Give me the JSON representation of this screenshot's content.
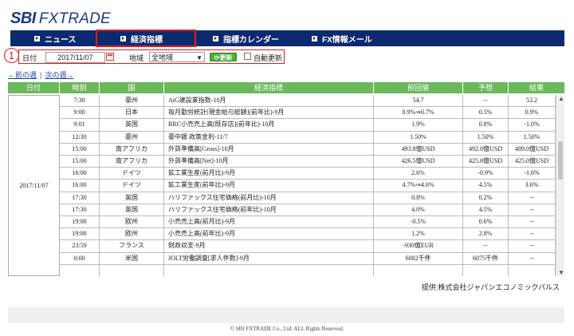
{
  "logo": {
    "sbi": "SBI",
    "fx": "FXTRADE"
  },
  "nav": [
    {
      "label": "ニュース"
    },
    {
      "label": "経済指標"
    },
    {
      "label": "指標カレンダー"
    },
    {
      "label": "FX情報メール"
    }
  ],
  "annotation_number": "1",
  "filter": {
    "date_label": "日付",
    "date_value": "2017/11/07",
    "region_label": "地域",
    "region_value": "全地域",
    "refresh_label": "更新",
    "auto_refresh_label": "自動更新"
  },
  "week_nav": {
    "prev": "←前の週",
    "next": "次の週→"
  },
  "table": {
    "headers": [
      "日付",
      "時刻",
      "国",
      "経済指標",
      "前回値",
      "予想",
      "結果"
    ],
    "date": "2017/11/07",
    "rows": [
      {
        "time": "7:30",
        "country": "豪州",
        "name": "AiG建設業指数-10月",
        "prev": "54.7",
        "fore": "--",
        "res": "53.2"
      },
      {
        "time": "9:00",
        "country": "日本",
        "name": "毎月勤労統計[現金給与総額](前年比)-9月",
        "prev": "0.9%⇒0.7%",
        "fore": "0.5%",
        "res": "0.9%"
      },
      {
        "time": "9:01",
        "country": "英国",
        "name": "BRC小売売上高[既存店](前年比)-10月",
        "prev": "1.9%",
        "fore": "0.8%",
        "res": "-1.0%"
      },
      {
        "time": "12:30",
        "country": "豪州",
        "name": "豪中銀 政策金利-11/7",
        "prev": "1.50%",
        "fore": "1.50%",
        "res": "1.50%"
      },
      {
        "time": "15:00",
        "country": "南アフリカ",
        "name": "外貨準備高[Gross]-10月",
        "prev": "493.8億USD",
        "fore": "492.0億USD",
        "res": "489.0億USD"
      },
      {
        "time": "15:00",
        "country": "南アフリカ",
        "name": "外貨準備高[Net]-10月",
        "prev": "426.5億USD",
        "fore": "425.0億USD",
        "res": "425.0億USD"
      },
      {
        "time": "16:00",
        "country": "ドイツ",
        "name": "鉱工業生産(前月比)-9月",
        "prev": "2.6%",
        "fore": "-0.9%",
        "res": "-1.6%"
      },
      {
        "time": "16:00",
        "country": "ドイツ",
        "name": "鉱工業生産(前年比)-9月",
        "prev": "4.7%⇒4.6%",
        "fore": "4.5%",
        "res": "3.6%"
      },
      {
        "time": "17:30",
        "country": "英国",
        "name": "ハリファックス住宅価格(前月比)-10月",
        "prev": "0.8%",
        "fore": "0.2%",
        "res": "--"
      },
      {
        "time": "17:30",
        "country": "英国",
        "name": "ハリファックス住宅価格(前年比)-10月",
        "prev": "4.0%",
        "fore": "4.5%",
        "res": "--"
      },
      {
        "time": "19:00",
        "country": "欧州",
        "name": "小売売上高(前月比)-9月",
        "prev": "-0.5%",
        "fore": "0.6%",
        "res": "--"
      },
      {
        "time": "19:00",
        "country": "欧州",
        "name": "小売売上高(前年比)-9月",
        "prev": "1.2%",
        "fore": "2.8%",
        "res": "--"
      },
      {
        "time": "23:59",
        "country": "フランス",
        "name": "財政収支-9月",
        "prev": "-930億EUR",
        "fore": "--",
        "res": "--"
      },
      {
        "time": "0:00",
        "country": "米国",
        "name": "JOLT労働調査[求人件数]-9月",
        "prev": "6082千件",
        "fore": "6075千件",
        "res": "--"
      },
      {
        "time": "",
        "country": "",
        "name": "",
        "prev": "",
        "fore": "",
        "res": ""
      }
    ]
  },
  "provider": "提供:株式会社ジャパンエコノミックパルス",
  "copyright": "© SBI FXTRADE Co., Ltd. ALL Rights Reserved."
}
